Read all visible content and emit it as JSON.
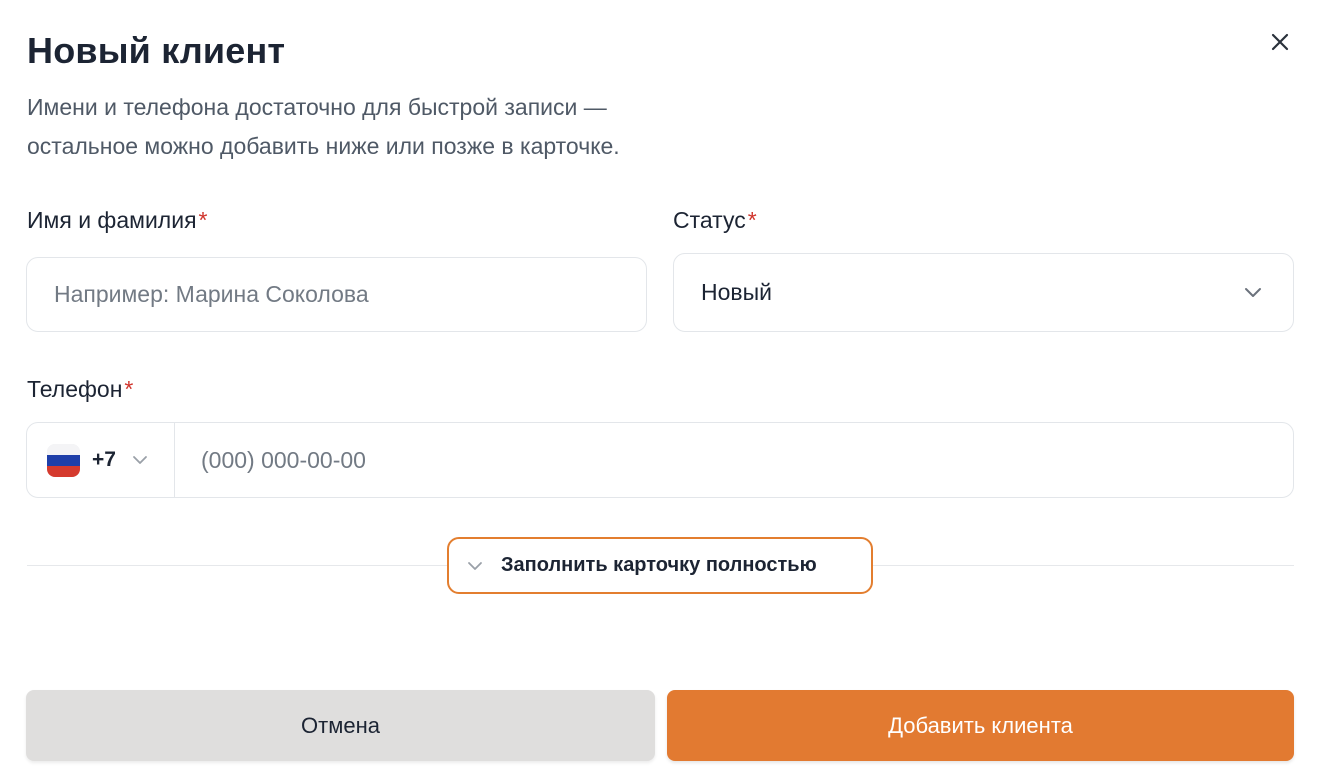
{
  "modal": {
    "title": "Новый клиент",
    "subtitle_line1": "Имени и телефона достаточно для быстрой записи —",
    "subtitle_line2": "остальное можно добавить ниже или позже в карточке.",
    "close_icon": "close-icon"
  },
  "fields": {
    "name": {
      "label": "Имя и фамилия",
      "required_mark": "*",
      "placeholder": "Например: Марина Соколова"
    },
    "status": {
      "label": "Статус",
      "required_mark": "*",
      "value": "Новый",
      "icon": "chevron-down-icon"
    },
    "phone": {
      "label": "Телефон",
      "required_mark": "*",
      "country_flag": "russia-flag-icon",
      "dial_code": "+7",
      "placeholder": "(000) 000-00-00"
    }
  },
  "expand": {
    "label": "Заполнить карточку полностью",
    "icon": "chevron-down-icon"
  },
  "actions": {
    "cancel_label": "Отмена",
    "submit_label": "Добавить клиента"
  },
  "colors": {
    "accent": "#e27a31",
    "required": "#d0342c",
    "cancel_bg": "#dfdedd"
  }
}
